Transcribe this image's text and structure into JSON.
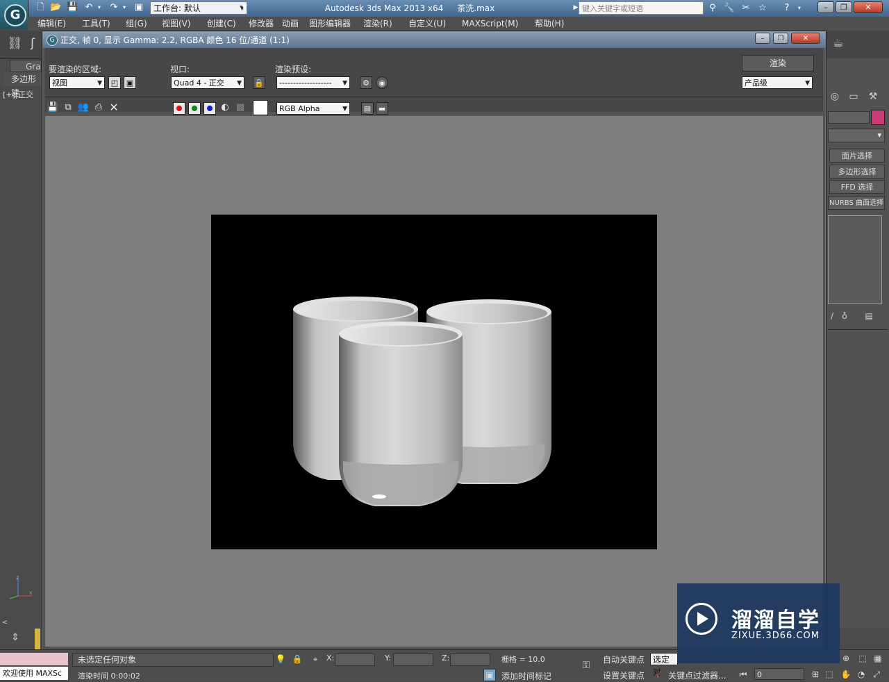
{
  "app": {
    "workspace": "工作台: 默认",
    "title": "Autodesk 3ds Max  2013 x64",
    "filename": "茶洗.max",
    "search_placeholder": "键入关键字或短语"
  },
  "menu": [
    "编辑(E)",
    "工具(T)",
    "组(G)",
    "视图(V)",
    "创建(C)",
    "修改器",
    "动画",
    "图形编辑器",
    "渲染(R)",
    "自定义(U)",
    "MAXScript(M)",
    "帮助(H)"
  ],
  "ribbon": {
    "tab": "Gra",
    "sub": "多边形建"
  },
  "viewport_label": "[+][正交",
  "command_panel": {
    "buttons": [
      "面片选择",
      "多边形选择",
      "FFD 选择",
      "NURBS 曲面选择"
    ],
    "color": "#c83a78"
  },
  "render_window": {
    "title": "正交, 帧 0, 显示 Gamma: 2.2, RGBA 颜色 16 位/通道 (1:1)",
    "area_label": "要渲染的区域:",
    "area_value": "视图",
    "viewport_label": "视口:",
    "viewport_value": "Quad 4 - 正交",
    "preset_label": "渲染预设:",
    "preset_value": "-------------------",
    "render_button": "渲染",
    "quality_value": "产品级",
    "channel_value": "RGB Alpha",
    "channels": [
      {
        "name": "red",
        "color": "#e01010"
      },
      {
        "name": "green",
        "color": "#0a8a1a"
      },
      {
        "name": "blue",
        "color": "#1020d0"
      }
    ]
  },
  "status": {
    "selection": "未选定任何对象",
    "render_time": "渲染时间  0:00:02",
    "maxscript": "欢迎使用 MAXSc",
    "x_label": "X:",
    "y_label": "Y:",
    "z_label": "Z:",
    "grid": "栅格 = 10.0",
    "auto_key": "自动关键点",
    "set_key": "设置关键点",
    "selected": "选定对",
    "key_filter": "关键点过滤器...",
    "add_time_tag": "添加时间标记",
    "frame": "0"
  },
  "watermark": {
    "name": "溜溜自学",
    "url": "ZIXUE.3D66.COM"
  }
}
